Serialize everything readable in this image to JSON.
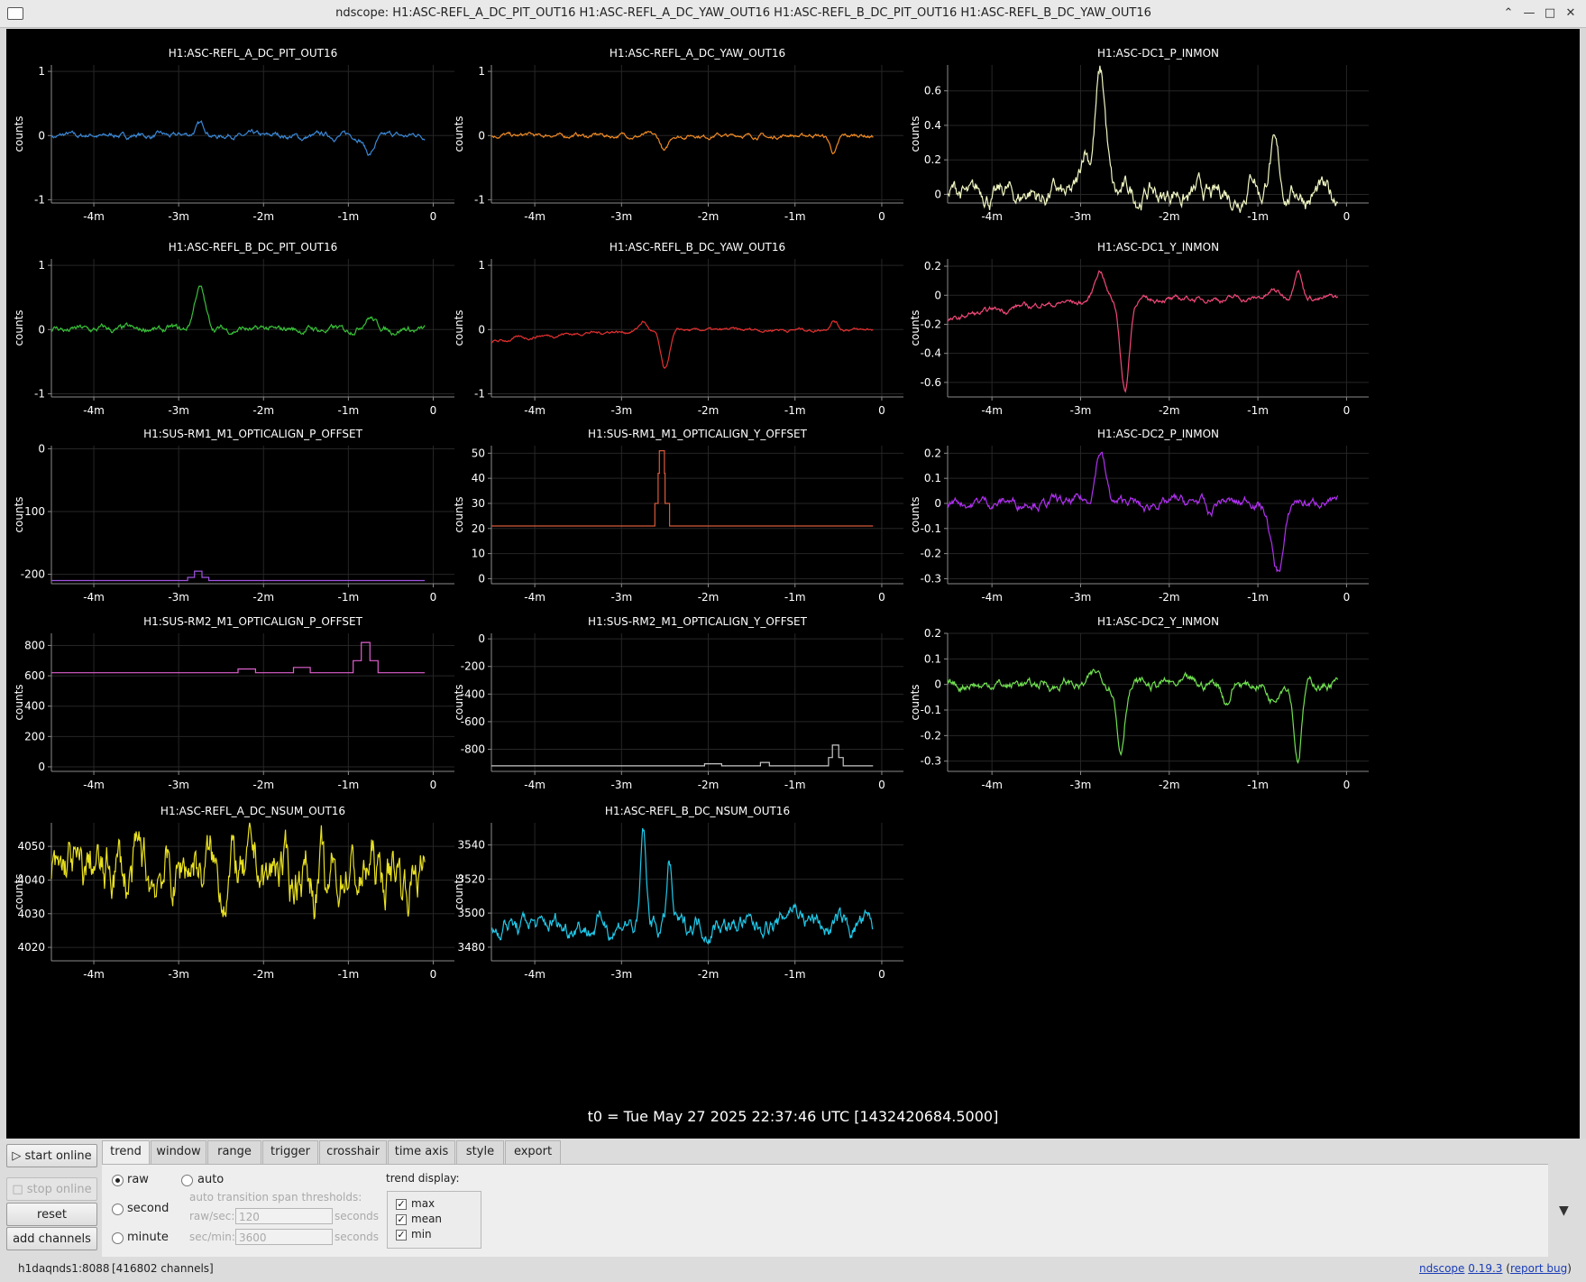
{
  "window": {
    "title": "ndscope: H1:ASC-REFL_A_DC_PIT_OUT16 H1:ASC-REFL_A_DC_YAW_OUT16 H1:ASC-REFL_B_DC_PIT_OUT16 H1:ASC-REFL_B_DC_YAW_OUT16",
    "controls": [
      "minimize-chevron",
      "minimize",
      "maximize",
      "close"
    ]
  },
  "t0_label": "t0 = Tue May 27 2025 22:37:46 UTC [1432420684.5000]",
  "side_buttons": {
    "start_online": "start online",
    "stop_online": "stop online",
    "reset": "reset",
    "add_channels": "add channels"
  },
  "tabs": [
    "trend",
    "window",
    "range",
    "trigger",
    "crosshair",
    "time axis",
    "style",
    "export"
  ],
  "active_tab": "trend",
  "trend": {
    "raw": "raw",
    "second": "second",
    "minute": "minute",
    "auto": "auto",
    "selected_mode": "raw",
    "threshold_title": "auto transition span thresholds:",
    "raw_sec_label": "raw/sec:",
    "raw_sec_value": "120",
    "sec_min_label": "sec/min:",
    "sec_min_value": "3600",
    "seconds_unit": "seconds",
    "trend_display_label": "trend display:",
    "display": [
      {
        "label": "max",
        "checked": true
      },
      {
        "label": "mean",
        "checked": true
      },
      {
        "label": "min",
        "checked": true
      }
    ]
  },
  "status": {
    "server": "h1daqnds1:8088",
    "channels": "[416802 channels]",
    "app_name": "ndscope",
    "version": "0.19.3",
    "open_paren": "(",
    "report_bug": "report bug",
    "close_paren": ")"
  },
  "xtick_labels": [
    "-4m",
    "-3m",
    "-2m",
    "-1m",
    "0"
  ],
  "y_axis_label": "counts",
  "plots": [
    {
      "title": "H1:ASC-REFL_A_DC_PIT_OUT16",
      "color": "#3a87d6",
      "yrange": [
        -1.05,
        1.1
      ],
      "yticks": [
        [
          1,
          "1"
        ],
        [
          0,
          "0"
        ],
        [
          -1,
          "-1"
        ]
      ],
      "base": 0,
      "noise": 0.025,
      "features": [
        [
          -2.75,
          0.18,
          0.08
        ],
        [
          -1.55,
          -0.06,
          0.06
        ],
        [
          -0.75,
          -0.3,
          0.08
        ]
      ],
      "xlast": -0.1
    },
    {
      "title": "H1:ASC-REFL_A_DC_YAW_OUT16",
      "color": "#f08a24",
      "yrange": [
        -1.05,
        1.1
      ],
      "yticks": [
        [
          1,
          "1"
        ],
        [
          0,
          "0"
        ],
        [
          -1,
          "-1"
        ]
      ],
      "base": 0,
      "noise": 0.02,
      "features": [
        [
          -2.5,
          -0.25,
          0.06
        ],
        [
          -0.55,
          -0.28,
          0.06
        ],
        [
          -1.3,
          -0.05,
          0.05
        ]
      ],
      "xlast": -0.1
    },
    {
      "title": "H1:ASC-DC1_P_INMON",
      "color": "#f0f5c0",
      "yrange": [
        -0.05,
        0.75
      ],
      "yticks": [
        [
          0.6,
          "0.6"
        ],
        [
          0.4,
          "0.4"
        ],
        [
          0.2,
          "0.2"
        ],
        [
          0,
          "0"
        ]
      ],
      "base": 0.0,
      "noise": 0.035,
      "features": [
        [
          -2.78,
          0.68,
          0.09
        ],
        [
          -2.95,
          0.25,
          0.06
        ],
        [
          -0.82,
          0.25,
          0.08
        ],
        [
          -1.05,
          0.12,
          0.06
        ]
      ],
      "xlast": -0.1
    },
    {
      "title": "H1:ASC-REFL_B_DC_PIT_OUT16",
      "color": "#38c038",
      "yrange": [
        -1.05,
        1.1
      ],
      "yticks": [
        [
          1,
          "1"
        ],
        [
          0,
          "0"
        ],
        [
          -1,
          "-1"
        ]
      ],
      "base": 0,
      "noise": 0.03,
      "features": [
        [
          -2.75,
          0.65,
          0.09
        ],
        [
          -0.75,
          0.22,
          0.09
        ]
      ],
      "xlast": -0.1
    },
    {
      "title": "H1:ASC-REFL_B_DC_YAW_OUT16",
      "color": "#e63030",
      "yrange": [
        -1.05,
        1.1
      ],
      "yticks": [
        [
          1,
          "1"
        ],
        [
          0,
          "0"
        ],
        [
          -1,
          "-1"
        ]
      ],
      "base": 0,
      "noise": 0.015,
      "features": [
        [
          -2.5,
          -0.62,
          0.07
        ],
        [
          -2.75,
          0.15,
          0.06
        ],
        [
          -0.55,
          0.15,
          0.06
        ]
      ],
      "drift": -0.2,
      "xlast": -0.1
    },
    {
      "title": "H1:ASC-DC1_Y_INMON",
      "color": "#f04878",
      "yrange": [
        -0.7,
        0.25
      ],
      "yticks": [
        [
          0.2,
          "0.2"
        ],
        [
          0,
          "0"
        ],
        [
          -0.2,
          "-0.2"
        ],
        [
          -0.4,
          "-0.4"
        ],
        [
          -0.6,
          "-0.6"
        ]
      ],
      "base": -0.02,
      "noise": 0.012,
      "features": [
        [
          -2.5,
          -0.62,
          0.07
        ],
        [
          -2.78,
          0.22,
          0.08
        ],
        [
          -0.55,
          0.22,
          0.06
        ],
        [
          -0.82,
          0.06,
          0.08
        ]
      ],
      "drift": -0.16,
      "xlast": -0.1
    },
    {
      "title": "H1:SUS-RM1_M1_OPTICALIGN_P_OFFSET",
      "color": "#a055e0",
      "yrange": [
        -215,
        5
      ],
      "yticks": [
        [
          0,
          "0"
        ],
        [
          -100,
          "-100"
        ],
        [
          -200,
          "-200"
        ]
      ],
      "step": true,
      "base": -210,
      "steps": [
        [
          -2.9,
          -2.65,
          -205
        ],
        [
          -2.82,
          -2.73,
          -195
        ]
      ],
      "xlast": -0.1
    },
    {
      "title": "H1:SUS-RM1_M1_OPTICALIGN_Y_OFFSET",
      "color": "#d85a3a",
      "yrange": [
        -2,
        53
      ],
      "yticks": [
        [
          50,
          "50"
        ],
        [
          40,
          "40"
        ],
        [
          30,
          "30"
        ],
        [
          20,
          "20"
        ],
        [
          10,
          "10"
        ],
        [
          0,
          "0"
        ]
      ],
      "step": true,
      "base": 21,
      "steps": [
        [
          -2.62,
          -2.45,
          30
        ],
        [
          -2.58,
          -2.5,
          42
        ],
        [
          -2.57,
          -2.51,
          51
        ]
      ],
      "xlast": -0.1
    },
    {
      "title": "H1:ASC-DC2_P_INMON",
      "color": "#b030f0",
      "yrange": [
        -0.32,
        0.23
      ],
      "yticks": [
        [
          0.2,
          "0.2"
        ],
        [
          0.1,
          "0.1"
        ],
        [
          0,
          "0"
        ],
        [
          -0.1,
          "-0.1"
        ],
        [
          -0.2,
          "-0.2"
        ],
        [
          -0.3,
          "-0.3"
        ]
      ],
      "base": 0.005,
      "noise": 0.012,
      "features": [
        [
          -2.78,
          0.2,
          0.08
        ],
        [
          -0.78,
          -0.28,
          0.1
        ],
        [
          -2.25,
          -0.03,
          0.08
        ],
        [
          -1.55,
          -0.05,
          0.05
        ]
      ],
      "xlast": -0.1
    },
    {
      "title": "H1:SUS-RM2_M1_OPTICALIGN_P_OFFSET",
      "color": "#e060d0",
      "yrange": [
        -30,
        880
      ],
      "yticks": [
        [
          800,
          "800"
        ],
        [
          600,
          "600"
        ],
        [
          400,
          "400"
        ],
        [
          200,
          "200"
        ],
        [
          0,
          "0"
        ]
      ],
      "step": true,
      "base": 620,
      "steps": [
        [
          -2.3,
          -2.1,
          645
        ],
        [
          -1.65,
          -1.45,
          655
        ],
        [
          -0.95,
          -0.65,
          700
        ],
        [
          -0.85,
          -0.75,
          820
        ]
      ],
      "xlast": -0.1
    },
    {
      "title": "H1:SUS-RM2_M1_OPTICALIGN_Y_OFFSET",
      "color": "#c8c8c8",
      "yrange": [
        -960,
        40
      ],
      "yticks": [
        [
          0,
          "0"
        ],
        [
          -200,
          "-200"
        ],
        [
          -400,
          "-400"
        ],
        [
          -600,
          "-600"
        ],
        [
          -800,
          "-800"
        ]
      ],
      "step": true,
      "base": -920,
      "steps": [
        [
          -2.05,
          -1.85,
          -905
        ],
        [
          -1.4,
          -1.3,
          -895
        ],
        [
          -0.62,
          -0.45,
          -860
        ],
        [
          -0.57,
          -0.5,
          -770
        ]
      ],
      "xlast": -0.1
    },
    {
      "title": "H1:ASC-DC2_Y_INMON",
      "color": "#70e050",
      "yrange": [
        -0.34,
        0.2
      ],
      "yticks": [
        [
          0.2,
          "0.2"
        ],
        [
          0.1,
          "0.1"
        ],
        [
          0,
          "0"
        ],
        [
          -0.1,
          "-0.1"
        ],
        [
          -0.2,
          "-0.2"
        ],
        [
          -0.3,
          "-0.3"
        ]
      ],
      "base": 0.0,
      "noise": 0.012,
      "features": [
        [
          -2.55,
          -0.26,
          0.06
        ],
        [
          -0.55,
          -0.28,
          0.06
        ],
        [
          -2.8,
          0.04,
          0.1
        ],
        [
          -1.35,
          -0.06,
          0.06
        ],
        [
          -0.85,
          -0.05,
          0.08
        ]
      ],
      "xlast": -0.1
    },
    {
      "title": "H1:ASC-REFL_A_DC_NSUM_OUT16",
      "color": "#e8e020",
      "yrange": [
        4016,
        4057
      ],
      "yticks": [
        [
          4050,
          "4050"
        ],
        [
          4040,
          "4040"
        ],
        [
          4030,
          "4030"
        ],
        [
          4020,
          "4020"
        ]
      ],
      "base": 4042,
      "noise": 5,
      "features": [
        [
          -1.25,
          -18,
          0.03
        ],
        [
          -2.8,
          8,
          0.05
        ]
      ],
      "xlast": -0.1
    },
    {
      "title": "H1:ASC-REFL_B_DC_NSUM_OUT16",
      "color": "#20c8e8",
      "yrange": [
        3472,
        3553
      ],
      "yticks": [
        [
          3540,
          "3540"
        ],
        [
          3520,
          "3520"
        ],
        [
          3500,
          "3500"
        ],
        [
          3480,
          "3480"
        ]
      ],
      "base": 3493,
      "noise": 3.5,
      "features": [
        [
          -2.75,
          55,
          0.04
        ],
        [
          -2.45,
          34,
          0.04
        ],
        [
          -1.0,
          10,
          0.15
        ]
      ],
      "xlast": -0.1
    }
  ]
}
